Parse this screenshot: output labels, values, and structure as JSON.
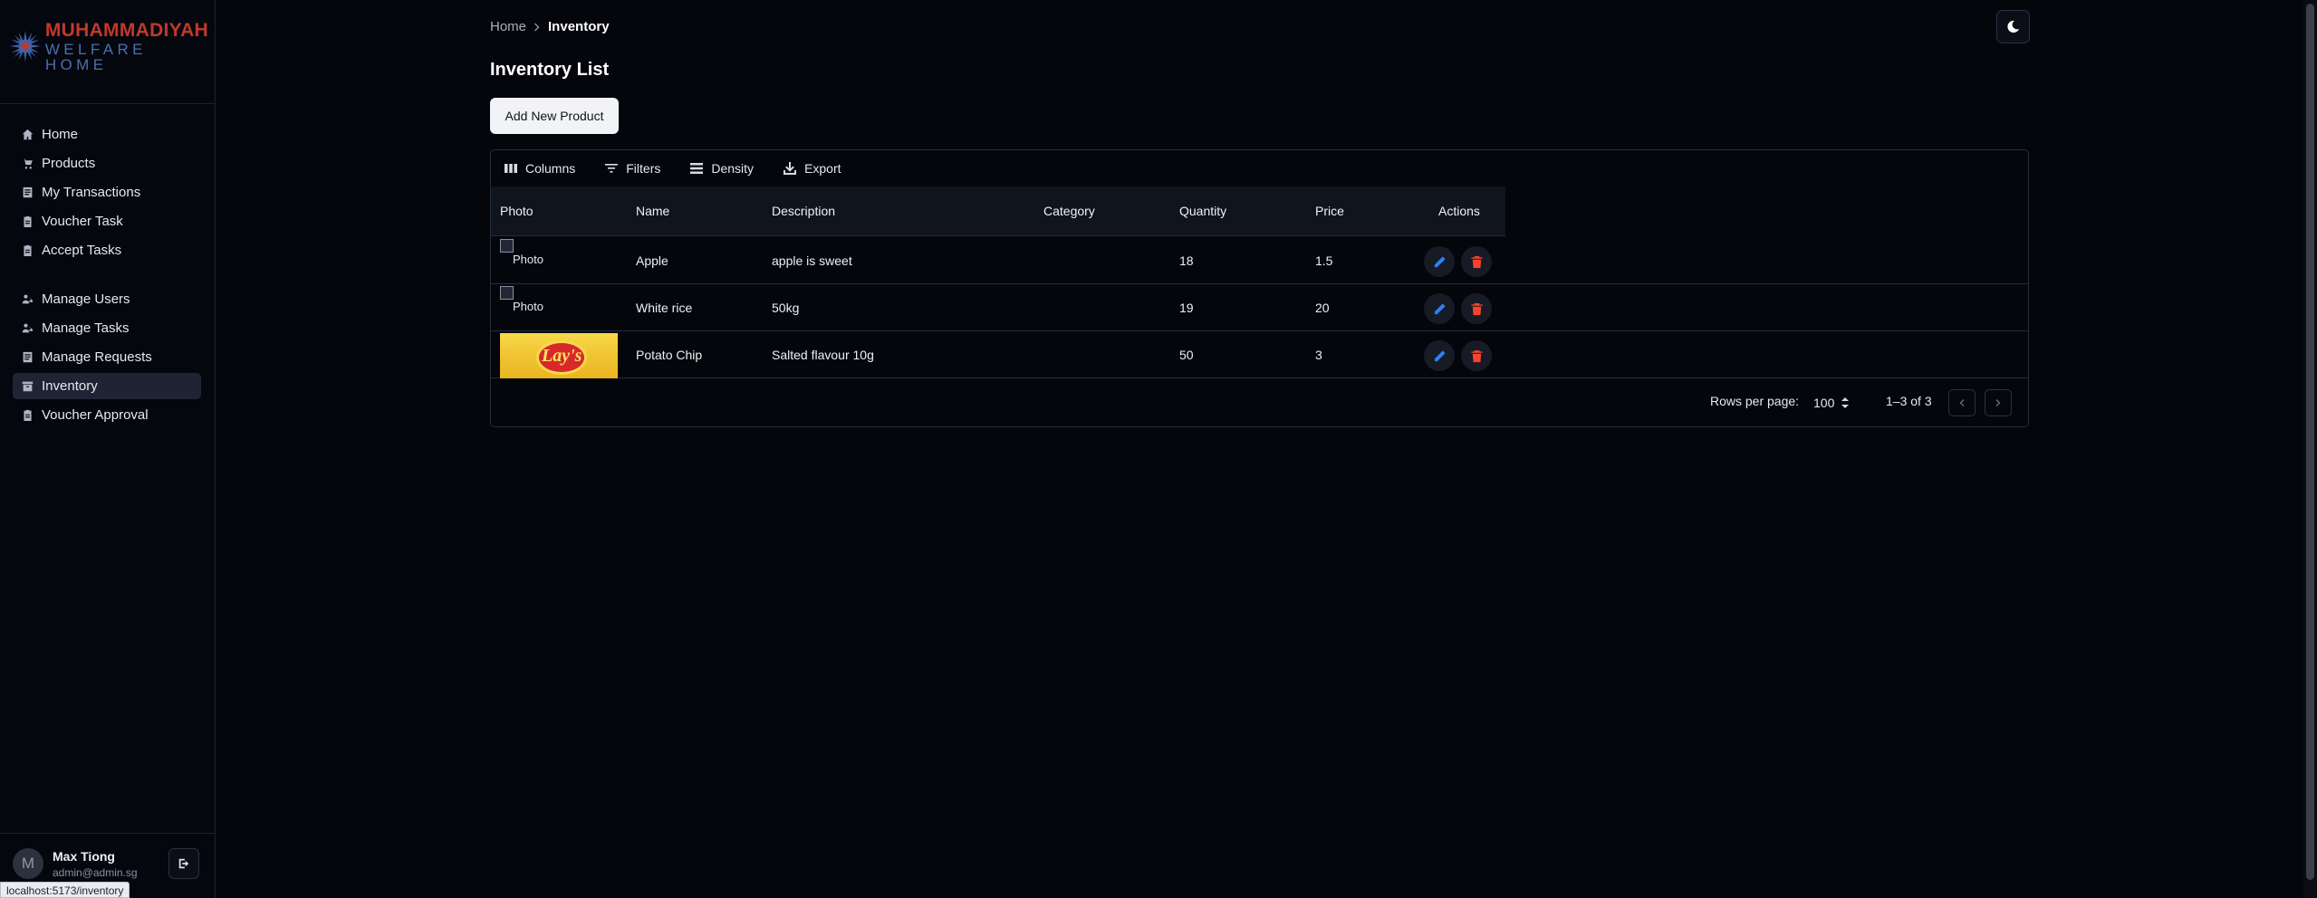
{
  "brand": {
    "line1": "MUHAMMADIYAH",
    "line2": "WELFARE HOME"
  },
  "sidebar": {
    "group1": [
      {
        "label": "Home",
        "icon": "home-icon"
      },
      {
        "label": "Products",
        "icon": "cart-icon"
      },
      {
        "label": "My Transactions",
        "icon": "receipt-icon"
      },
      {
        "label": "Voucher Task",
        "icon": "clipboard-icon"
      },
      {
        "label": "Accept Tasks",
        "icon": "clipboard-icon"
      }
    ],
    "group2": [
      {
        "label": "Manage Users",
        "icon": "users-icon"
      },
      {
        "label": "Manage Tasks",
        "icon": "users-icon"
      },
      {
        "label": "Manage Requests",
        "icon": "receipt-icon"
      },
      {
        "label": "Inventory",
        "icon": "inventory-icon",
        "active": true
      },
      {
        "label": "Voucher Approval",
        "icon": "clipboard-icon"
      }
    ]
  },
  "user": {
    "initial": "M",
    "name": "Max Tiong",
    "email": "admin@admin.sg"
  },
  "status_url": "localhost:5173/inventory",
  "breadcrumb": {
    "home": "Home",
    "current": "Inventory"
  },
  "page": {
    "title": "Inventory List",
    "add_button": "Add New Product"
  },
  "toolbar": {
    "columns": "Columns",
    "filters": "Filters",
    "density": "Density",
    "export": "Export"
  },
  "table": {
    "headers": {
      "photo": "Photo",
      "name": "Name",
      "description": "Description",
      "category": "Category",
      "quantity": "Quantity",
      "price": "Price",
      "actions": "Actions"
    },
    "rows": [
      {
        "photo_alt": "Photo",
        "name": "Apple",
        "description": "apple is sweet",
        "category": "",
        "quantity": "18",
        "price": "1.5"
      },
      {
        "photo_alt": "Photo",
        "name": "White rice",
        "description": "50kg",
        "category": "",
        "quantity": "19",
        "price": "20"
      },
      {
        "photo_alt": "",
        "photo_brand": "Lay's",
        "name": "Potato Chip",
        "description": "Salted flavour 10g",
        "category": "",
        "quantity": "50",
        "price": "3"
      }
    ]
  },
  "pagination": {
    "rows_per_page_label": "Rows per page:",
    "rows_per_page": "100",
    "range": "1–3 of 3"
  },
  "colors": {
    "accent_edit": "#2f7ff5",
    "accent_delete": "#f5442d",
    "brand_red": "#c0392b",
    "brand_blue": "#4b6fb0"
  }
}
